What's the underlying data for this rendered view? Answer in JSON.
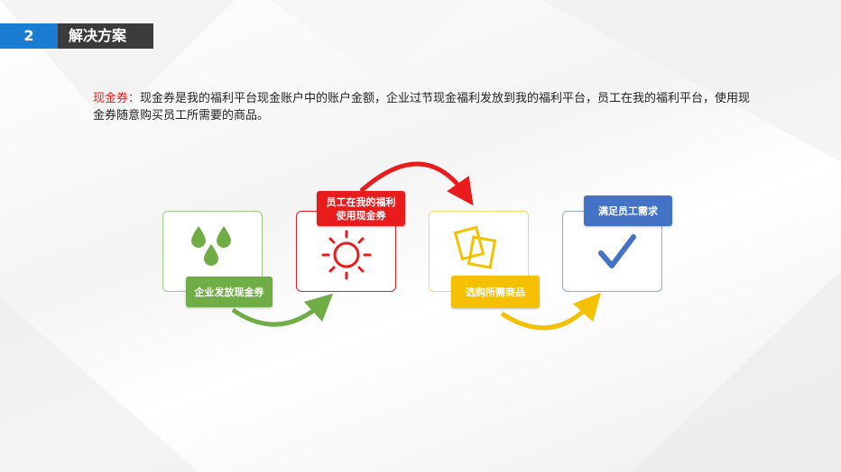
{
  "section": {
    "number": "2",
    "title": "解决方案"
  },
  "intro": {
    "term": "现金券：",
    "text_line1": "现金券是我的福利平台现金账户中的账户金额，企业过节现金福利发放到我的福利平台，员工在我的福利平台，使用现",
    "text_line2": "金券随意购买员工所需要的商品。"
  },
  "steps": [
    {
      "label": "企业发放现金券",
      "color": "#70ad47",
      "icon": "water-drops-icon"
    },
    {
      "label_line1": "员工在我的福利",
      "label_line2": "使用现金券",
      "color": "#e81c1c",
      "icon": "sun-icon"
    },
    {
      "label": "选购所需商品",
      "color": "#f5c000",
      "icon": "cards-icon"
    },
    {
      "label": "满足员工需求",
      "color": "#4472c4",
      "icon": "checkmark-icon"
    }
  ]
}
